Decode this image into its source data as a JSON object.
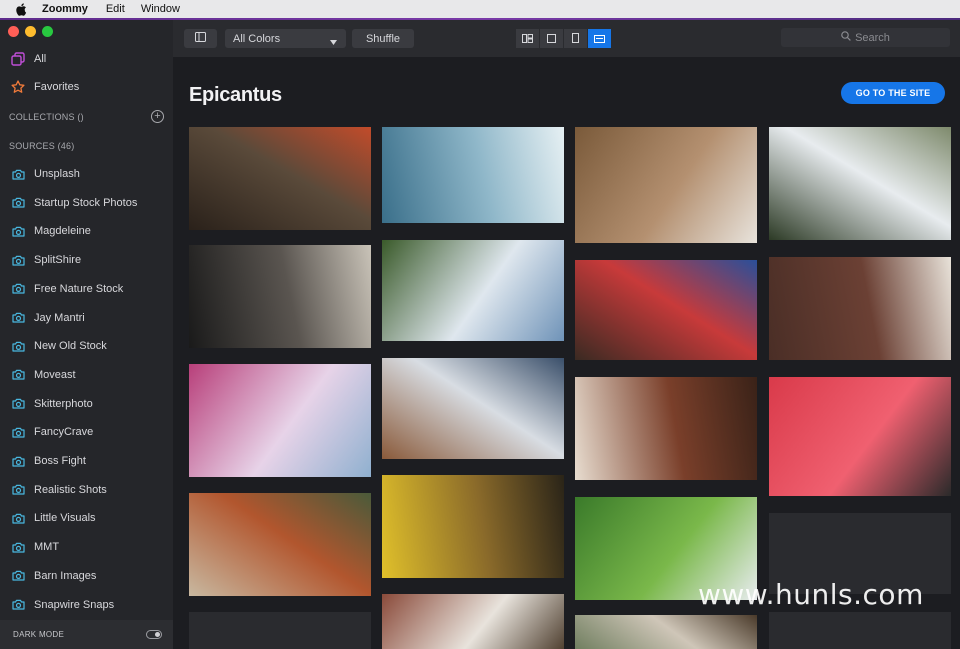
{
  "menubar": {
    "app_name": "Zoommy",
    "menus": [
      "Edit",
      "Window"
    ]
  },
  "sidebar": {
    "all_label": "All",
    "favorites_label": "Favorites",
    "collections_label": "COLLECTIONS ()",
    "sources_label": "SOURCES (46)",
    "sources": [
      "Unsplash",
      "Startup Stock Photos",
      "Magdeleine",
      "SplitShire",
      "Free Nature Stock",
      "Jay Mantri",
      "New Old Stock",
      "Moveast",
      "Skitterphoto",
      "FancyCrave",
      "Boss Fight",
      "Realistic Shots",
      "Little Visuals",
      "MMT",
      "Barn Images",
      "Snapwire Snaps"
    ],
    "dark_mode_label": "DARK MODE",
    "dark_mode_on": true
  },
  "toolbar": {
    "color_filter": "All Colors",
    "shuffle_label": "Shuffle",
    "search_placeholder": "Search",
    "active_view": "large"
  },
  "main": {
    "source_title": "Epicantus",
    "goto_label": "GO TO THE SITE"
  },
  "photos": [
    {
      "subject": "cutting vegetables on board",
      "palette": [
        "#2a211a",
        "#5a4a3a",
        "#c24b2a"
      ]
    },
    {
      "subject": "ocean wave",
      "palette": [
        "#3a6f8a",
        "#8fb7c9",
        "#e6f0f3"
      ]
    },
    {
      "subject": "cafe table with cups",
      "palette": [
        "#7a5a3a",
        "#b49070",
        "#e8e3dc"
      ]
    },
    {
      "subject": "white hydrangeas street",
      "palette": [
        "#2c3a25",
        "#e8ecef",
        "#7e8a6c"
      ]
    },
    {
      "subject": "window interior",
      "palette": [
        "#1a1a1a",
        "#5a5550",
        "#c9c3b8"
      ]
    },
    {
      "subject": "canal house",
      "palette": [
        "#3a5a2a",
        "#dfe7ee",
        "#6f93b8"
      ]
    },
    {
      "subject": "storefront with dutch flag",
      "palette": [
        "#3a2a22",
        "#c83a3a",
        "#2a4f9a"
      ]
    },
    {
      "subject": "brick wall sign",
      "palette": [
        "#4a2e26",
        "#6b4034",
        "#e8e2d9"
      ]
    },
    {
      "subject": "pink round building",
      "palette": [
        "#b83f7a",
        "#e7d3e8",
        "#8fb0cf"
      ]
    },
    {
      "subject": "modern building",
      "palette": [
        "#8a5a3a",
        "#d8dde3",
        "#3a4f6a"
      ]
    },
    {
      "subject": "carved wooden heart",
      "palette": [
        "#e8ddd0",
        "#7a3f2a",
        "#3a2218"
      ]
    },
    {
      "subject": "red apartment building",
      "palette": [
        "#d93a4a",
        "#f06070",
        "#2a2a2a"
      ]
    },
    {
      "subject": "old town rooftops",
      "palette": [
        "#c8b8a0",
        "#b2562e",
        "#4a5a3a"
      ]
    },
    {
      "subject": "lemons",
      "palette": [
        "#e0c02a",
        "#8a6a2a",
        "#2a2418"
      ]
    },
    {
      "subject": "basil leaves",
      "palette": [
        "#3a7a2a",
        "#7ab84a",
        "#e8ecef"
      ]
    },
    {
      "subject": "dark placeholder",
      "palette": [
        "#2a2b2f",
        "#2a2b2f",
        "#2a2b2f"
      ]
    },
    {
      "subject": "dark placeholder",
      "palette": [
        "#2a2b2f",
        "#2a2b2f",
        "#2a2b2f"
      ]
    },
    {
      "subject": "brick gate",
      "palette": [
        "#8a4a3a",
        "#e8e3dc",
        "#4a3a2a"
      ]
    },
    {
      "subject": "street houses",
      "palette": [
        "#6a7a5a",
        "#cfc6b8",
        "#4a3a2a"
      ]
    },
    {
      "subject": "dark placeholder",
      "palette": [
        "#2a2b2f",
        "#2a2b2f",
        "#2a2b2f"
      ]
    }
  ],
  "watermark": "www.hunls.com"
}
